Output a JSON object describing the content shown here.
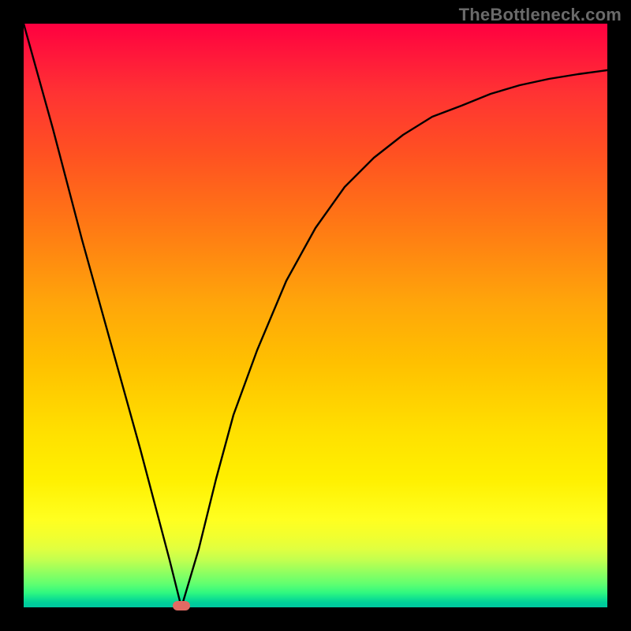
{
  "watermark": {
    "text": "TheBottleneck.com"
  },
  "colors": {
    "marker": "#e26a63",
    "curve": "#000000"
  },
  "chart_data": {
    "type": "line",
    "title": "",
    "xlabel": "",
    "ylabel": "",
    "xlim": [
      0,
      100
    ],
    "ylim": [
      0,
      100
    ],
    "grid": false,
    "legend": false,
    "annotations": [
      "TheBottleneck.com"
    ],
    "series": [
      {
        "name": "curve",
        "x": [
          0,
          5,
          10,
          15,
          20,
          25,
          27,
          30,
          33,
          36,
          40,
          45,
          50,
          55,
          60,
          65,
          70,
          75,
          80,
          85,
          90,
          95,
          100
        ],
        "y": [
          100,
          82,
          63,
          45,
          27,
          8,
          0,
          10,
          22,
          33,
          44,
          56,
          65,
          72,
          77,
          81,
          84,
          86,
          88,
          89.5,
          90.5,
          91.3,
          92
        ]
      }
    ],
    "marker": {
      "x": 27,
      "y": 0,
      "shape": "rounded-rect",
      "color": "#e26a63"
    }
  }
}
